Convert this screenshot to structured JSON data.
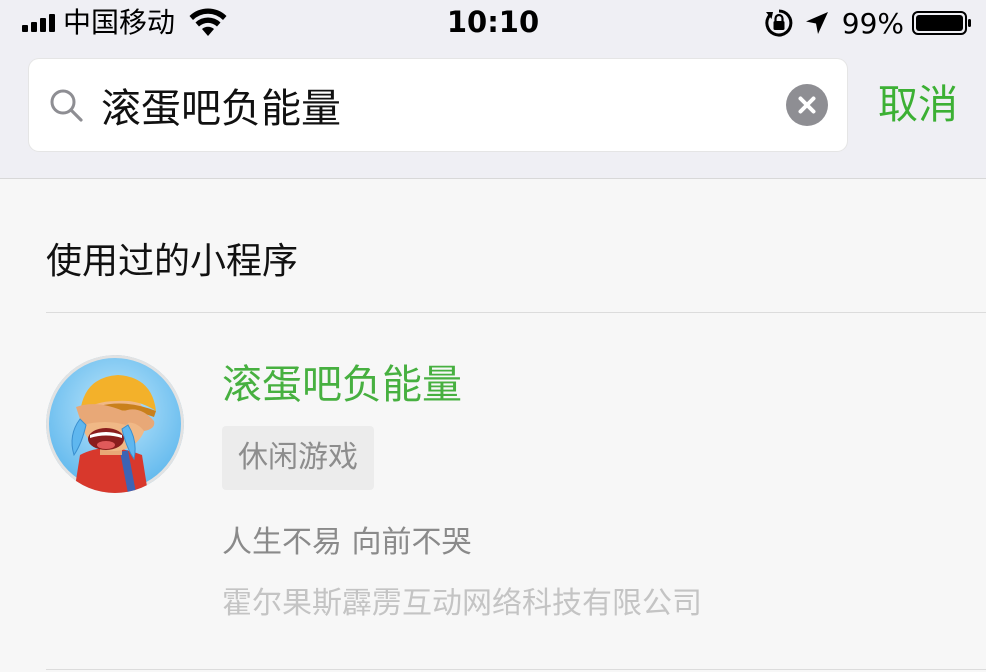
{
  "status_bar": {
    "carrier": "中国移动",
    "time": "10:10",
    "battery_percent": "99%",
    "battery_level": 0.99,
    "icons": [
      "signal-icon",
      "wifi-icon",
      "rotation-lock-icon",
      "location-arrow-icon",
      "battery-icon"
    ]
  },
  "search": {
    "value": "滚蛋吧负能量",
    "placeholder": "",
    "cancel_label": "取消",
    "icons": [
      "search-icon",
      "clear-icon"
    ]
  },
  "results": {
    "section_title": "使用过的小程序",
    "items": [
      {
        "name": "滚蛋吧负能量",
        "tag": "休闲游戏",
        "description": "人生不易 向前不哭",
        "company": "霍尔果斯霹雳互动网络科技有限公司",
        "icon": "cartoon-boy-avatar"
      }
    ]
  },
  "colors": {
    "accent_green": "#3cb034",
    "app_name_green": "#47b040",
    "header_bg": "#efeff4",
    "page_bg": "#f7f7f7"
  }
}
